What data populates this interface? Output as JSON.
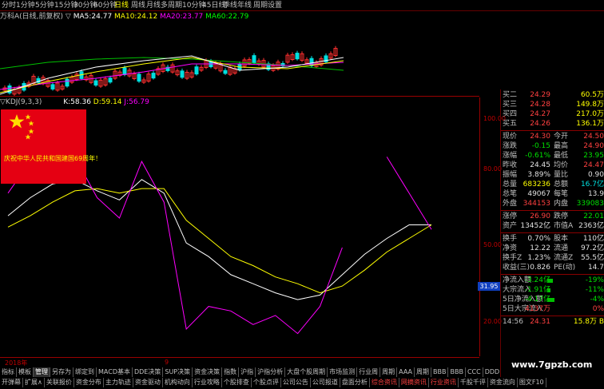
{
  "period_tabs": [
    "分时",
    "1分钟",
    "5分钟",
    "15分钟",
    "30分钟",
    "60分钟",
    "日线",
    "周线",
    "月线",
    "多周期",
    "10分钟",
    "45日线",
    "季线",
    "年线",
    "周期设置"
  ],
  "active_period": "日线",
  "stock_label": "万科A(日线,前复权)",
  "ma": {
    "prefix": "▽",
    "ma5_label": "MA5:",
    "ma5": "24.77",
    "ma10_label": "MA10:",
    "ma10": "24.12",
    "ma20_label": "MA20:",
    "ma20": "23.77",
    "ma60_label": "MA60:",
    "ma60": "22.79"
  },
  "kdj": {
    "title": "▽KDJ(9,3,3)",
    "k_label": "K:",
    "k": "58.36",
    "d_label": "D:",
    "d": "59.14",
    "j_label": "J:",
    "j": "56.79"
  },
  "kdj_axis": [
    "100.00",
    "80.00",
    "50.00",
    "20.00"
  ],
  "current_axis_value": "31.95",
  "flag_text": "庆祝中华人民共和国建国69周年！",
  "time_axis": {
    "year": "2018年",
    "month": "9"
  },
  "quote_rows": [
    {
      "l": "买二",
      "v1": "24.29",
      "v1c": "red",
      "v2": "60.5万",
      "v2c": "yellow"
    },
    {
      "l": "买三",
      "v1": "24.28",
      "v1c": "red",
      "v2": "149.8万",
      "v2c": "yellow"
    },
    {
      "l": "买四",
      "v1": "24.27",
      "v1c": "red",
      "v2": "217.0万",
      "v2c": "yellow"
    },
    {
      "l": "买五",
      "v1": "24.26",
      "v1c": "red",
      "v2": "136.1万",
      "v2c": "yellow"
    }
  ],
  "quote_detail": [
    {
      "l": "现价",
      "v1": "24.30",
      "v1c": "red",
      "l2": "今开",
      "v2": "24.50",
      "v2c": "red"
    },
    {
      "l": "涨跌",
      "v1": "-0.15",
      "v1c": "green",
      "l2": "最高",
      "v2": "24.90",
      "v2c": "red"
    },
    {
      "l": "涨幅",
      "v1": "-0.61%",
      "v1c": "green",
      "l2": "最低",
      "v2": "23.95",
      "v2c": "green"
    },
    {
      "l": "昨收",
      "v1": "24.45",
      "v1c": "white",
      "l2": "均价",
      "v2": "24.47",
      "v2c": "red"
    },
    {
      "l": "振幅",
      "v1": "3.89%",
      "v1c": "white",
      "l2": "量比",
      "v2": "0.90",
      "v2c": "white"
    },
    {
      "l": "总量",
      "v1": "683236",
      "v1c": "yellow",
      "l2": "总额",
      "v2": "16.7亿",
      "v2c": "cyan"
    },
    {
      "l": "总笔",
      "v1": "49067",
      "v1c": "white",
      "l2": "每笔",
      "v2": "13.9",
      "v2c": "white"
    },
    {
      "l": "外盘",
      "v1": "344153",
      "v1c": "red",
      "l2": "内盘",
      "v2": "339083",
      "v2c": "green"
    },
    {
      "l": "涨停",
      "v1": "26.90",
      "v1c": "red",
      "l2": "跌停",
      "v2": "22.01",
      "v2c": "green"
    },
    {
      "l": "资产",
      "v1": "13452亿",
      "v1c": "white",
      "l2": "市值A",
      "v2": "2363亿",
      "v2c": "white"
    },
    {
      "l": "换手",
      "v1": "0.70%",
      "v1c": "white",
      "l2": "股本",
      "v2": "110亿",
      "v2c": "white"
    },
    {
      "l": "净资",
      "v1": "12.22",
      "v1c": "white",
      "l2": "流通",
      "v2": "97.2亿",
      "v2c": "white"
    },
    {
      "l": "换手Z",
      "v1": "1.23%",
      "v1c": "white",
      "l2": "流通Z",
      "v2": "55.5亿",
      "v2c": "white"
    },
    {
      "l": "收益(三)",
      "v1": "0.826",
      "v1c": "white",
      "l2": "PE(动)",
      "v2": "14.7",
      "v2c": "white"
    }
  ],
  "flow_rows": [
    {
      "l": "净流入额",
      "v1": "-3.24亿",
      "v1c": "green",
      "v2": "-19%",
      "v2c": "green",
      "bar": 0.35
    },
    {
      "l": "大宗流入",
      "v1": "-1.91亿",
      "v1c": "green",
      "v2": "-11%",
      "v2c": "green",
      "bar": 0.2
    },
    {
      "l": "5日净流入额",
      "v1": "-4.17亿",
      "v1c": "green",
      "v2": "-4%",
      "v2c": "green",
      "bar": 0.45
    },
    {
      "l": "5日大宗流入",
      "v1": "4137万",
      "v1c": "red",
      "v2": "0%",
      "v2c": "red",
      "bar": 0
    }
  ],
  "tick_row": {
    "time": "14:56",
    "price": "24.31",
    "vol": "15.8万",
    "dir": "B"
  },
  "tabs_row1": [
    "指标",
    "模板",
    "管理",
    "另存为",
    "绑定到",
    "MACD基本",
    "DDE决策",
    "SUP决策",
    "资金决策",
    "指数",
    "沪指",
    "沪指分析",
    "大盘个股周期",
    "市场监测",
    "行业周",
    "周期",
    "AAA",
    "周期",
    "BBB",
    "BBB",
    "CCC",
    "DDD",
    "板板",
    "涨幅"
  ],
  "tabs_row1_active": "管理",
  "tabs_row2": [
    "开弹幕",
    "扩展∧",
    "关联报价",
    "资金分布",
    "主力轨迹",
    "资金驱动",
    "机构动向",
    "行业攻略",
    "个股排查",
    "个股点评",
    "公司公告",
    "公司报道",
    "盘面分析",
    "综合资讯",
    "网摘资讯",
    "行业资讯",
    "千股千评",
    "资金流向",
    "图文F10"
  ],
  "tabs_row2_hl": [
    "综合资讯",
    "网摘资讯",
    "行业资讯"
  ],
  "watermark": "www.7gpzb.com",
  "chart_data": {
    "type": "line",
    "title": "▽KDJ(9,3,3)",
    "ylim": [
      0,
      110
    ],
    "yticks": [
      100,
      80,
      50,
      20
    ],
    "series": [
      {
        "name": "K",
        "color": "#ffffff",
        "values": [
          62,
          70,
          76,
          78,
          73,
          69,
          78,
          72,
          50,
          44,
          36,
          32,
          28,
          25,
          27,
          36,
          45,
          52,
          58,
          58
        ]
      },
      {
        "name": "D",
        "color": "#ffff00",
        "values": [
          57,
          62,
          68,
          73,
          74,
          72,
          74,
          74,
          60,
          52,
          44,
          40,
          35,
          32,
          28,
          31,
          38,
          46,
          52,
          58
        ]
      },
      {
        "name": "J",
        "color": "#ff00ff",
        "values": [
          72,
          86,
          92,
          88,
          70,
          61,
          86,
          68,
          12,
          22,
          20,
          14,
          18,
          10,
          22,
          48,
          null,
          88,
          72,
          56
        ]
      }
    ]
  }
}
